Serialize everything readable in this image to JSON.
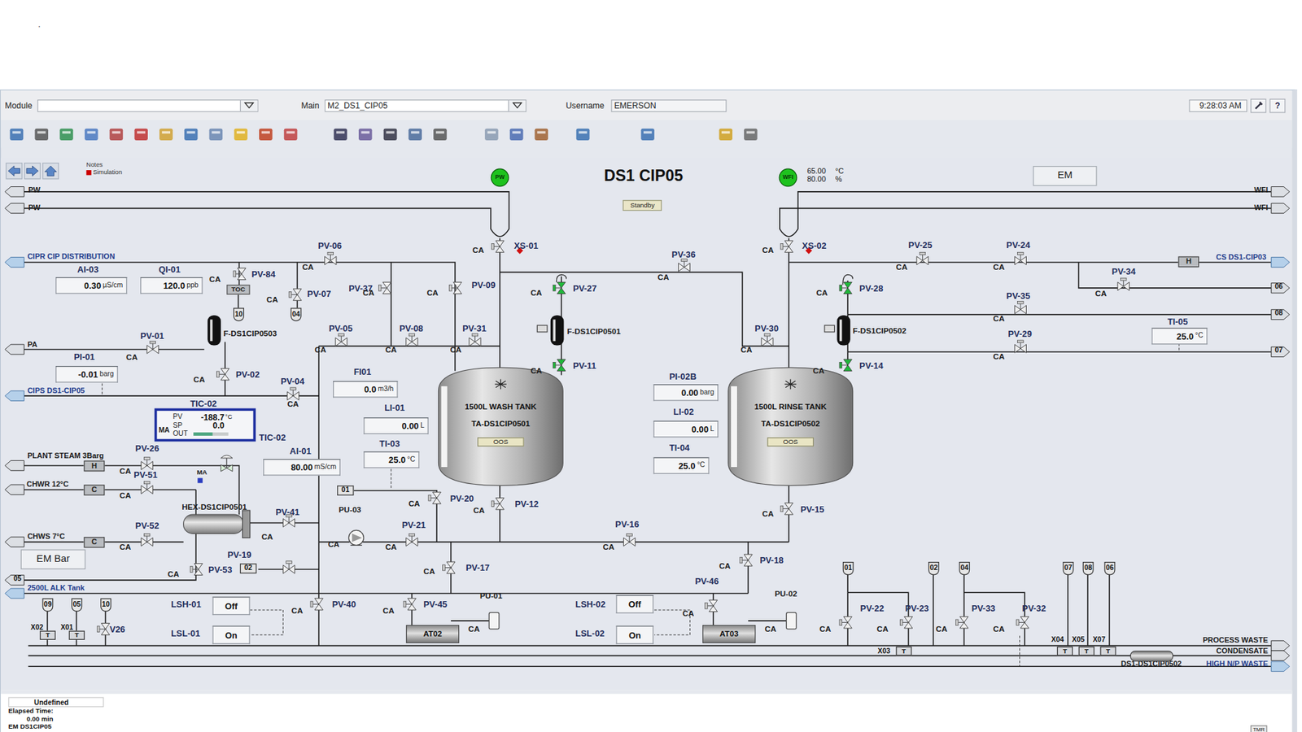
{
  "top": {
    "mark": "."
  },
  "header": {
    "module_label": "Module",
    "main_label": "Main",
    "main_value": "M2_DS1_CIP05",
    "username_label": "Username",
    "username_value": "EMERSON",
    "time": "9:28:03 AM",
    "help": "?"
  },
  "diagram": {
    "title": "DS1 CIP05",
    "status": "Standby",
    "em_button": "EM",
    "em_bar_button": "EM Bar",
    "notes": {
      "label": "Notes",
      "legend": "Simulation",
      "legend_color": "#cc0000"
    },
    "sources": [
      {
        "label": "PW",
        "color": "#1ec21e"
      },
      {
        "label": "WFI",
        "color": "#1ec21e"
      }
    ],
    "wfi_readings": [
      {
        "value": "65.00",
        "unit": "°C"
      },
      {
        "value": "80.00",
        "unit": "%"
      }
    ],
    "line_labels": [
      {
        "text": "PW",
        "kind": "line"
      },
      {
        "text": "PW",
        "kind": "line"
      },
      {
        "text": "WFI",
        "kind": "line"
      },
      {
        "text": "WFI",
        "kind": "line"
      },
      {
        "text": "CIPR CIP DISTRIBUTION",
        "kind": "link"
      },
      {
        "text": "PA",
        "kind": "line"
      },
      {
        "text": "CIPS DS1-CIP05",
        "kind": "link"
      },
      {
        "text": "PLANT STEAM 3Barg",
        "kind": "line"
      },
      {
        "text": "CHWR 12°C",
        "kind": "line"
      },
      {
        "text": "CHWS 7°C",
        "kind": "line"
      },
      {
        "text": "2500L ALK Tank",
        "kind": "link"
      },
      {
        "text": "CS DS1-CIP03",
        "kind": "link"
      },
      {
        "text": "PROCESS WASTE",
        "kind": "line"
      },
      {
        "text": "CONDENSATE",
        "kind": "line"
      },
      {
        "text": "HIGH N/P WASTE",
        "kind": "link"
      },
      {
        "text": "DS1-DS1CIP0502",
        "kind": "line"
      }
    ],
    "equipment_labels": [
      "HEX-DS1CIP0501",
      "F-DS1CIP0503",
      "F-DS1CIP0501",
      "F-DS1CIP0502",
      "PU-03",
      "PU-01",
      "PU-02"
    ],
    "tanks": [
      {
        "name": "1500L WASH TANK",
        "tag": "TA-DS1CIP0501",
        "status": "OOS"
      },
      {
        "name": "1500L RINSE TANK",
        "tag": "TA-DS1CIP0502",
        "status": "OOS"
      }
    ],
    "agitators": [
      "AT02",
      "AT03"
    ],
    "valves": [
      {
        "tag": "PV-06",
        "open": false,
        "alarm": false
      },
      {
        "tag": "PV-84",
        "open": false,
        "alarm": false
      },
      {
        "tag": "PV-07",
        "open": false,
        "alarm": false
      },
      {
        "tag": "PV-37",
        "open": false,
        "alarm": false
      },
      {
        "tag": "PV-09",
        "open": false,
        "alarm": false
      },
      {
        "tag": "PV-27",
        "open": true,
        "alarm": false
      },
      {
        "tag": "PV-36",
        "open": false,
        "alarm": false
      },
      {
        "tag": "PV-25",
        "open": false,
        "alarm": false
      },
      {
        "tag": "PV-24",
        "open": false,
        "alarm": false
      },
      {
        "tag": "PV-34",
        "open": false,
        "alarm": false
      },
      {
        "tag": "PV-28",
        "open": true,
        "alarm": false
      },
      {
        "tag": "PV-35",
        "open": false,
        "alarm": false
      },
      {
        "tag": "PV-29",
        "open": false,
        "alarm": false
      },
      {
        "tag": "PV-01",
        "open": false,
        "alarm": false
      },
      {
        "tag": "PV-02",
        "open": false,
        "alarm": false
      },
      {
        "tag": "PV-05",
        "open": false,
        "alarm": false
      },
      {
        "tag": "PV-08",
        "open": false,
        "alarm": false
      },
      {
        "tag": "PV-31",
        "open": false,
        "alarm": false
      },
      {
        "tag": "PV-11",
        "open": true,
        "alarm": false
      },
      {
        "tag": "PV-30",
        "open": false,
        "alarm": false
      },
      {
        "tag": "PV-14",
        "open": true,
        "alarm": false
      },
      {
        "tag": "PV-04",
        "open": false,
        "alarm": false
      },
      {
        "tag": "PV-26",
        "open": false,
        "alarm": false
      },
      {
        "tag": "PV-51",
        "open": false,
        "alarm": false
      },
      {
        "tag": "PV-52",
        "open": false,
        "alarm": false
      },
      {
        "tag": "PV-53",
        "open": false,
        "alarm": false
      },
      {
        "tag": "PV-41",
        "open": false,
        "alarm": false
      },
      {
        "tag": "PV-19",
        "open": false,
        "alarm": false
      },
      {
        "tag": "PV-20",
        "open": false,
        "alarm": false
      },
      {
        "tag": "PV-21",
        "open": false,
        "alarm": false
      },
      {
        "tag": "PV-12",
        "open": false,
        "alarm": false
      },
      {
        "tag": "PV-16",
        "open": false,
        "alarm": false
      },
      {
        "tag": "PV-15",
        "open": false,
        "alarm": false
      },
      {
        "tag": "PV-17",
        "open": false,
        "alarm": false
      },
      {
        "tag": "PV-18",
        "open": false,
        "alarm": false
      },
      {
        "tag": "PV-40",
        "open": false,
        "alarm": false
      },
      {
        "tag": "PV-45",
        "open": false,
        "alarm": false
      },
      {
        "tag": "PV-46",
        "open": false,
        "alarm": false
      },
      {
        "tag": "PV-22",
        "open": false,
        "alarm": false
      },
      {
        "tag": "PV-23",
        "open": false,
        "alarm": false
      },
      {
        "tag": "PV-33",
        "open": false,
        "alarm": false
      },
      {
        "tag": "PV-32",
        "open": false,
        "alarm": false
      },
      {
        "tag": "XS-01",
        "open": false,
        "alarm": true
      },
      {
        "tag": "XS-02",
        "open": false,
        "alarm": true
      },
      {
        "tag": "V26",
        "open": false,
        "alarm": false
      }
    ],
    "ca_labels": [
      "CA",
      "CA",
      "CA",
      "CA",
      "CA",
      "CA",
      "CA",
      "CA",
      "CA",
      "CA",
      "CA",
      "CA",
      "CA",
      "CA",
      "CA",
      "CA",
      "CA",
      "CA",
      "CA",
      "CA",
      "CA",
      "CA",
      "CA",
      "CA",
      "CA",
      "CA",
      "CA",
      "CA",
      "CA",
      "CA",
      "CA",
      "CA",
      "CA",
      "CA",
      "CA",
      "CA",
      "CA",
      "CA",
      "CA",
      "CA",
      "CA",
      "CA",
      "CA",
      "CA",
      "CA",
      "CA"
    ],
    "readouts": [
      {
        "tag": "AI-03",
        "value": "0.30",
        "unit": "µS/cm"
      },
      {
        "tag": "QI-01",
        "value": "120.0",
        "unit": "ppb"
      },
      {
        "tag": "PI-01",
        "value": "-0.01",
        "unit": "barg"
      },
      {
        "tag": "FI01",
        "value": "0.0",
        "unit": "m3/h"
      },
      {
        "tag": "LI-01",
        "value": "0.00",
        "unit": "L"
      },
      {
        "tag": "TI-03",
        "value": "25.0",
        "unit": "°C"
      },
      {
        "tag": "PI-02B",
        "value": "0.00",
        "unit": "barg"
      },
      {
        "tag": "LI-02",
        "value": "0.00",
        "unit": "L"
      },
      {
        "tag": "TI-04",
        "value": "25.0",
        "unit": "°C"
      },
      {
        "tag": "TI-05",
        "value": "25.0",
        "unit": "°C"
      },
      {
        "tag": "AI-01",
        "value": "80.00",
        "unit": "mS/cm"
      }
    ],
    "switches": [
      {
        "tag": "LSH-01",
        "state": "Off"
      },
      {
        "tag": "LSL-01",
        "state": "On"
      },
      {
        "tag": "LSH-02",
        "state": "Off"
      },
      {
        "tag": "LSL-02",
        "state": "On"
      }
    ],
    "controller": {
      "tag_top": "TIC-02",
      "tag_side": "TIC-02",
      "mode": "MA",
      "pv_label": "PV",
      "pv": "-188.7",
      "pv_unit": "°C",
      "sp_label": "SP",
      "sp": "0.0",
      "out_label": "OUT",
      "out_level": 0.55
    },
    "valve_mode": "MA",
    "analyzer": "TOC",
    "utility_boxes": [
      "H",
      "C",
      "C",
      "H"
    ],
    "connectors": [
      "10",
      "04",
      "09",
      "05",
      "10",
      "01",
      "02",
      "04",
      "07",
      "08",
      "06",
      "01",
      "02",
      "05",
      "06",
      "08",
      "07"
    ],
    "traps": [
      {
        "tag": "X02",
        "symbol": "T"
      },
      {
        "tag": "X01",
        "symbol": "T"
      },
      {
        "tag": "X03",
        "symbol": "T"
      },
      {
        "tag": "X04",
        "symbol": "T"
      },
      {
        "tag": "X05",
        "symbol": "T"
      },
      {
        "tag": "X07",
        "symbol": "T"
      }
    ]
  },
  "footer": {
    "state": "Undefined",
    "elapsed_label": "Elapsed Time:",
    "elapsed": "0.00 min",
    "module": "EM DS1CIP05",
    "timer": "TMR"
  }
}
